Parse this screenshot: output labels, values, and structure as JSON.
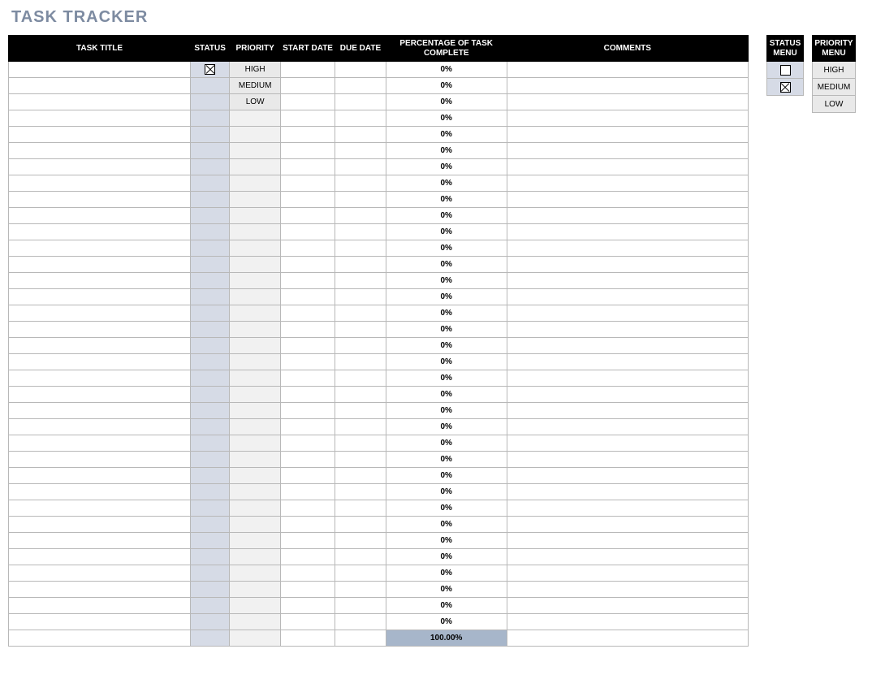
{
  "title": "TASK TRACKER",
  "headers": {
    "task_title": "TASK TITLE",
    "status": "STATUS",
    "priority": "PRIORITY",
    "start_date": "START DATE",
    "due_date": "DUE DATE",
    "pct_complete": "PERCENTAGE OF TASK COMPLETE",
    "comments": "COMMENTS"
  },
  "rows": [
    {
      "task_title": "",
      "status_checked": true,
      "priority": "HIGH",
      "start_date": "",
      "due_date": "",
      "pct": "0%",
      "comments": ""
    },
    {
      "task_title": "",
      "status_checked": false,
      "priority": "MEDIUM",
      "start_date": "",
      "due_date": "",
      "pct": "0%",
      "comments": ""
    },
    {
      "task_title": "",
      "status_checked": false,
      "priority": "LOW",
      "start_date": "",
      "due_date": "",
      "pct": "0%",
      "comments": ""
    },
    {
      "task_title": "",
      "status_checked": false,
      "priority": "",
      "start_date": "",
      "due_date": "",
      "pct": "0%",
      "comments": ""
    },
    {
      "task_title": "",
      "status_checked": false,
      "priority": "",
      "start_date": "",
      "due_date": "",
      "pct": "0%",
      "comments": ""
    },
    {
      "task_title": "",
      "status_checked": false,
      "priority": "",
      "start_date": "",
      "due_date": "",
      "pct": "0%",
      "comments": ""
    },
    {
      "task_title": "",
      "status_checked": false,
      "priority": "",
      "start_date": "",
      "due_date": "",
      "pct": "0%",
      "comments": ""
    },
    {
      "task_title": "",
      "status_checked": false,
      "priority": "",
      "start_date": "",
      "due_date": "",
      "pct": "0%",
      "comments": ""
    },
    {
      "task_title": "",
      "status_checked": false,
      "priority": "",
      "start_date": "",
      "due_date": "",
      "pct": "0%",
      "comments": ""
    },
    {
      "task_title": "",
      "status_checked": false,
      "priority": "",
      "start_date": "",
      "due_date": "",
      "pct": "0%",
      "comments": ""
    },
    {
      "task_title": "",
      "status_checked": false,
      "priority": "",
      "start_date": "",
      "due_date": "",
      "pct": "0%",
      "comments": ""
    },
    {
      "task_title": "",
      "status_checked": false,
      "priority": "",
      "start_date": "",
      "due_date": "",
      "pct": "0%",
      "comments": ""
    },
    {
      "task_title": "",
      "status_checked": false,
      "priority": "",
      "start_date": "",
      "due_date": "",
      "pct": "0%",
      "comments": ""
    },
    {
      "task_title": "",
      "status_checked": false,
      "priority": "",
      "start_date": "",
      "due_date": "",
      "pct": "0%",
      "comments": ""
    },
    {
      "task_title": "",
      "status_checked": false,
      "priority": "",
      "start_date": "",
      "due_date": "",
      "pct": "0%",
      "comments": ""
    },
    {
      "task_title": "",
      "status_checked": false,
      "priority": "",
      "start_date": "",
      "due_date": "",
      "pct": "0%",
      "comments": ""
    },
    {
      "task_title": "",
      "status_checked": false,
      "priority": "",
      "start_date": "",
      "due_date": "",
      "pct": "0%",
      "comments": ""
    },
    {
      "task_title": "",
      "status_checked": false,
      "priority": "",
      "start_date": "",
      "due_date": "",
      "pct": "0%",
      "comments": ""
    },
    {
      "task_title": "",
      "status_checked": false,
      "priority": "",
      "start_date": "",
      "due_date": "",
      "pct": "0%",
      "comments": ""
    },
    {
      "task_title": "",
      "status_checked": false,
      "priority": "",
      "start_date": "",
      "due_date": "",
      "pct": "0%",
      "comments": ""
    },
    {
      "task_title": "",
      "status_checked": false,
      "priority": "",
      "start_date": "",
      "due_date": "",
      "pct": "0%",
      "comments": ""
    },
    {
      "task_title": "",
      "status_checked": false,
      "priority": "",
      "start_date": "",
      "due_date": "",
      "pct": "0%",
      "comments": ""
    },
    {
      "task_title": "",
      "status_checked": false,
      "priority": "",
      "start_date": "",
      "due_date": "",
      "pct": "0%",
      "comments": ""
    },
    {
      "task_title": "",
      "status_checked": false,
      "priority": "",
      "start_date": "",
      "due_date": "",
      "pct": "0%",
      "comments": ""
    },
    {
      "task_title": "",
      "status_checked": false,
      "priority": "",
      "start_date": "",
      "due_date": "",
      "pct": "0%",
      "comments": ""
    },
    {
      "task_title": "",
      "status_checked": false,
      "priority": "",
      "start_date": "",
      "due_date": "",
      "pct": "0%",
      "comments": ""
    },
    {
      "task_title": "",
      "status_checked": false,
      "priority": "",
      "start_date": "",
      "due_date": "",
      "pct": "0%",
      "comments": ""
    },
    {
      "task_title": "",
      "status_checked": false,
      "priority": "",
      "start_date": "",
      "due_date": "",
      "pct": "0%",
      "comments": ""
    },
    {
      "task_title": "",
      "status_checked": false,
      "priority": "",
      "start_date": "",
      "due_date": "",
      "pct": "0%",
      "comments": ""
    },
    {
      "task_title": "",
      "status_checked": false,
      "priority": "",
      "start_date": "",
      "due_date": "",
      "pct": "0%",
      "comments": ""
    },
    {
      "task_title": "",
      "status_checked": false,
      "priority": "",
      "start_date": "",
      "due_date": "",
      "pct": "0%",
      "comments": ""
    },
    {
      "task_title": "",
      "status_checked": false,
      "priority": "",
      "start_date": "",
      "due_date": "",
      "pct": "0%",
      "comments": ""
    },
    {
      "task_title": "",
      "status_checked": false,
      "priority": "",
      "start_date": "",
      "due_date": "",
      "pct": "0%",
      "comments": ""
    },
    {
      "task_title": "",
      "status_checked": false,
      "priority": "",
      "start_date": "",
      "due_date": "",
      "pct": "0%",
      "comments": ""
    },
    {
      "task_title": "",
      "status_checked": false,
      "priority": "",
      "start_date": "",
      "due_date": "",
      "pct": "0%",
      "comments": ""
    }
  ],
  "total_label": "100.00%",
  "side": {
    "status_menu_header": "STATUS MENU",
    "status_menu": [
      {
        "checked": false
      },
      {
        "checked": true
      }
    ],
    "priority_menu_header": "PRIORITY MENU",
    "priority_menu": [
      "HIGH",
      "MEDIUM",
      "LOW"
    ]
  }
}
